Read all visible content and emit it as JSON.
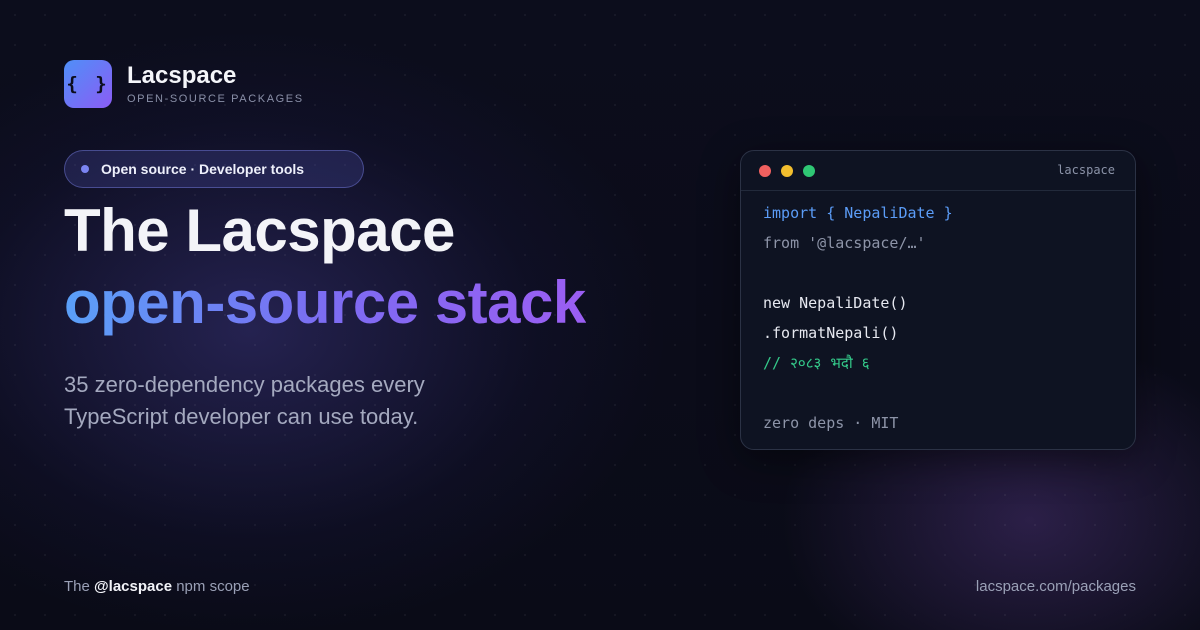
{
  "brand": {
    "logo_glyph": "{ }",
    "name": "Lacspace",
    "tagline": "OPEN-SOURCE PACKAGES"
  },
  "pill": {
    "label": "Open source · Developer tools"
  },
  "headline": {
    "line1": "The Lacspace",
    "line2": "open-source stack"
  },
  "subheading": "35 zero-dependency packages every TypeScript developer can use today.",
  "code_window": {
    "title": "lacspace",
    "lines": [
      "import { NepaliDate }",
      "from '@lacspace/…'",
      "",
      "new NepaliDate()",
      ".formatNepali()",
      "// २०८३ भदौ ६",
      "",
      "zero deps · MIT"
    ]
  },
  "footer": {
    "prefix": "The",
    "scope": "@lacspace",
    "suffix": "npm scope",
    "url": "lacspace.com/packages"
  },
  "colors": {
    "accent_blue": "#5b9cf7",
    "accent_purple": "#8b5cf6",
    "comment_green": "#34c98a",
    "background": "#0a0b17"
  },
  "icons": [
    "curly-braces-logo-icon",
    "dot-icon",
    "traffic-light-icons"
  ]
}
